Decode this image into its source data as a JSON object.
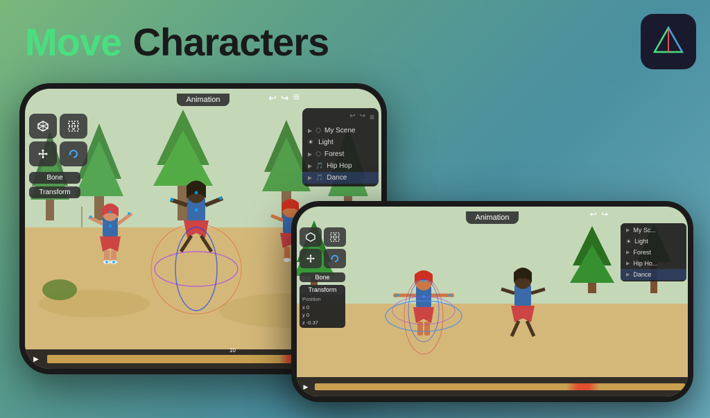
{
  "title": {
    "move": "Move",
    "characters": "Characters"
  },
  "appIcon": {
    "label": "App Icon"
  },
  "phoneBack": {
    "topBar": {
      "animationLabel": "Animation"
    },
    "leftToolbar": {
      "boneButton": "Bone",
      "transformButton": "Transform"
    },
    "rightPanel": {
      "items": [
        {
          "label": "My Scene",
          "hasArrow": true
        },
        {
          "label": "Light",
          "hasArrow": false,
          "icon": "sun"
        },
        {
          "label": "Forest",
          "hasArrow": true
        },
        {
          "label": "Hip Hop",
          "hasArrow": true
        },
        {
          "label": "Dance",
          "hasArrow": true,
          "active": true
        }
      ]
    },
    "timeline": {
      "playLabel": "▶"
    }
  },
  "phoneFront": {
    "topBar": {
      "animationLabel": "Animation"
    },
    "leftToolbar": {
      "boneButton": "Bone",
      "transformButton": "Transform"
    },
    "transformPanel": {
      "title": "Transform",
      "positionLabel": "Position",
      "x": "x  0",
      "y": "y  0",
      "z": "z  -0.37"
    },
    "rightPanel": {
      "items": [
        {
          "label": "My Sc...",
          "hasArrow": true
        },
        {
          "label": "Light",
          "hasArrow": false,
          "icon": "sun"
        },
        {
          "label": "Forest",
          "hasArrow": true
        },
        {
          "label": "Hip Ho...",
          "hasArrow": true
        },
        {
          "label": "Dance",
          "hasArrow": true,
          "active": true
        }
      ]
    },
    "timeline": {
      "playLabel": "▶"
    }
  }
}
